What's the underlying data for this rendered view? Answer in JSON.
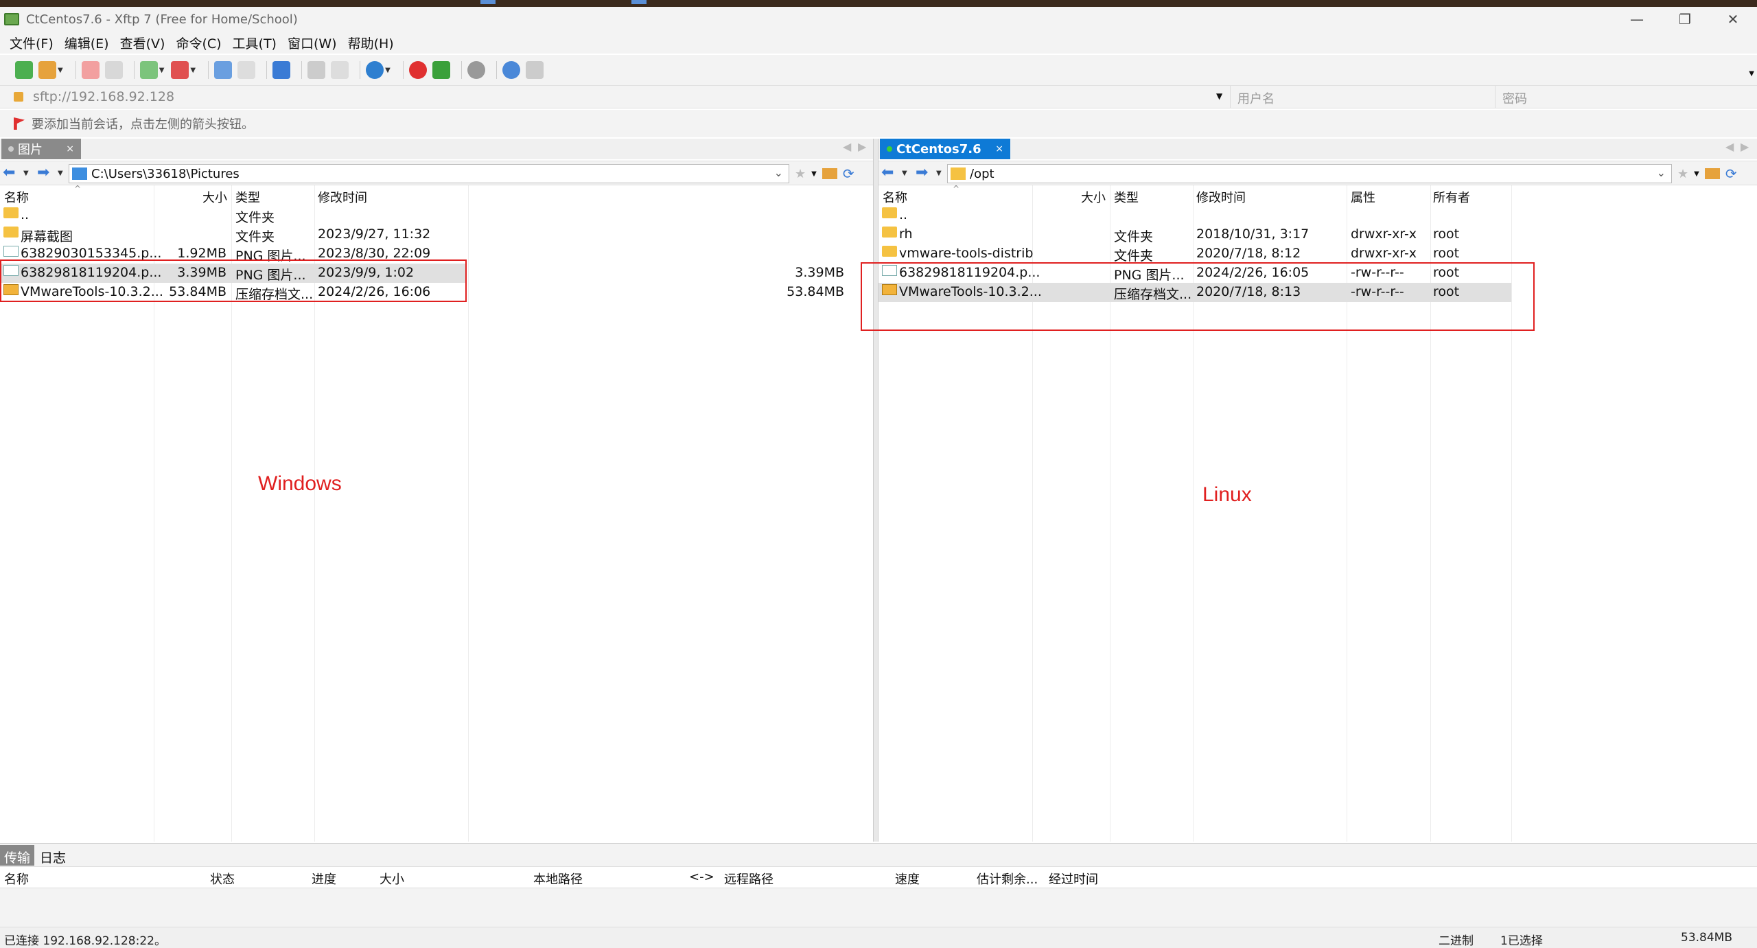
{
  "window": {
    "title": "CtCentos7.6 - Xftp 7 (Free for Home/School)",
    "controls": {
      "minimize": "—",
      "maximize": "❐",
      "close": "✕"
    }
  },
  "menu": [
    "文件(F)",
    "编辑(E)",
    "查看(V)",
    "命令(C)",
    "工具(T)",
    "窗口(W)",
    "帮助(H)"
  ],
  "address": {
    "url": "sftp://192.168.92.128",
    "username_placeholder": "用户名",
    "password_placeholder": "密码"
  },
  "hint": "要添加当前会话，点击左侧的箭头按钮。",
  "left_pane": {
    "tab_label": "图片",
    "path": "C:\\Users\\33618\\Pictures",
    "columns": [
      "名称",
      "大小",
      "类型",
      "修改时间"
    ],
    "rows": [
      {
        "name": "..",
        "size": "",
        "type": "文件夹",
        "modified": "",
        "icon": "folder-icon"
      },
      {
        "name": "屏幕截图",
        "size": "",
        "type": "文件夹",
        "modified": "2023/9/27, 11:32",
        "icon": "folder-icon"
      },
      {
        "name": "63829030153345.p...",
        "size": "1.92MB",
        "type": "PNG 图片...",
        "modified": "2023/8/30, 22:09",
        "icon": "png-file-icon"
      },
      {
        "name": "63829818119204.p...",
        "size": "3.39MB",
        "type": "PNG 图片...",
        "modified": "2023/9/9, 1:02",
        "icon": "png-file-icon"
      },
      {
        "name": "VMwareTools-10.3.2...",
        "size": "53.84MB",
        "type": "压缩存档文...",
        "modified": "2024/2/26, 16:06",
        "icon": "archive-file-icon"
      }
    ],
    "annotation": "Windows"
  },
  "right_pane": {
    "tab_label": "CtCentos7.6",
    "path": "/opt",
    "columns": [
      "名称",
      "大小",
      "类型",
      "修改时间",
      "属性",
      "所有者"
    ],
    "rows": [
      {
        "name": "..",
        "size": "",
        "type": "",
        "modified": "",
        "attrs": "",
        "owner": "",
        "icon": "folder-icon"
      },
      {
        "name": "rh",
        "size": "",
        "type": "文件夹",
        "modified": "2018/10/31, 3:17",
        "attrs": "drwxr-xr-x",
        "owner": "root",
        "icon": "folder-icon"
      },
      {
        "name": "vmware-tools-distrib",
        "size": "",
        "type": "文件夹",
        "modified": "2020/7/18, 8:12",
        "attrs": "drwxr-xr-x",
        "owner": "root",
        "icon": "folder-icon"
      },
      {
        "name": "63829818119204.p...",
        "size": "3.39MB",
        "type": "PNG 图片...",
        "modified": "2024/2/26, 16:05",
        "attrs": "-rw-r--r--",
        "owner": "root",
        "icon": "png-file-icon"
      },
      {
        "name": "VMwareTools-10.3.2...",
        "size": "53.84MB",
        "type": "压缩存档文...",
        "modified": "2020/7/18, 8:13",
        "attrs": "-rw-r--r--",
        "owner": "root",
        "icon": "archive-file-icon"
      }
    ],
    "annotation": "Linux"
  },
  "bottom_tabs": [
    "传输",
    "日志"
  ],
  "transfer_columns": [
    "名称",
    "状态",
    "进度",
    "大小",
    "本地路径",
    "<->",
    "远程路径",
    "速度",
    "估计剩余...",
    "经过时间"
  ],
  "status": {
    "connection": "已连接 192.168.92.128:22。",
    "mode": "二进制",
    "selection": "1已选择",
    "size": "53.84MB"
  },
  "colors": {
    "active_tab": "#0e7ad6",
    "inactive_tab": "#8a8a8a",
    "annotation_red": "#e02020",
    "selected_row": "#e0e0e0"
  }
}
